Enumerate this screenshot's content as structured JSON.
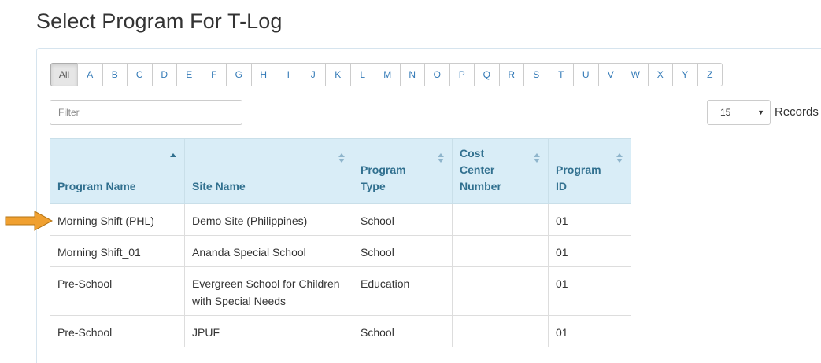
{
  "page": {
    "title": "Select Program For T-Log"
  },
  "alphabet": [
    "All",
    "A",
    "B",
    "C",
    "D",
    "E",
    "F",
    "G",
    "H",
    "I",
    "J",
    "K",
    "L",
    "M",
    "N",
    "O",
    "P",
    "Q",
    "R",
    "S",
    "T",
    "U",
    "V",
    "W",
    "X",
    "Y",
    "Z"
  ],
  "active_letter": "All",
  "filter": {
    "placeholder": "Filter",
    "value": ""
  },
  "records": {
    "selected": "15",
    "label": "Records"
  },
  "table": {
    "columns": [
      {
        "label": "Program Name",
        "sort": "asc"
      },
      {
        "label": "Site Name",
        "sort": "none"
      },
      {
        "label": "Program Type",
        "sort": "none"
      },
      {
        "label": "Cost Center Number",
        "sort": "none"
      },
      {
        "label": "Program ID",
        "sort": "none"
      }
    ],
    "rows": [
      {
        "program_name": "Morning Shift (PHL)",
        "site_name": "Demo Site (Philippines)",
        "program_type": "School",
        "cost_center": "",
        "program_id": "01"
      },
      {
        "program_name": "Morning Shift_01",
        "site_name": "Ananda Special School",
        "program_type": "School",
        "cost_center": "",
        "program_id": "01"
      },
      {
        "program_name": "Pre-School",
        "site_name": "Evergreen School for Children with Special Needs",
        "program_type": "Education",
        "cost_center": "",
        "program_id": "01"
      },
      {
        "program_name": "Pre-School",
        "site_name": "JPUF",
        "program_type": "School",
        "cost_center": "",
        "program_id": "01"
      }
    ]
  },
  "colors": {
    "header_bg": "#d9edf7",
    "header_text": "#31708f",
    "link": "#337ab7",
    "arrow": "#f0a030"
  },
  "icons": {
    "sort": "sort-icon",
    "pointer": "arrow-pointer-icon"
  }
}
